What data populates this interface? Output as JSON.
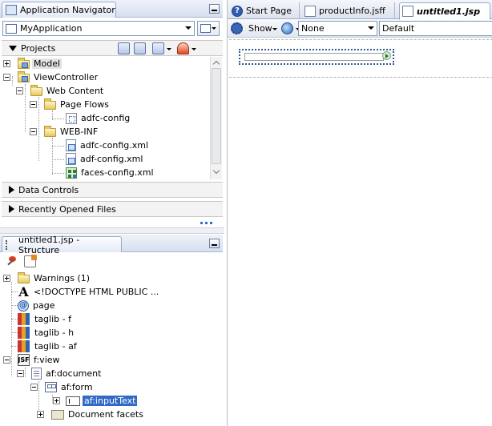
{
  "navigator": {
    "title": "Application Navigator",
    "application": "MyApplication",
    "sections": {
      "projects": "Projects",
      "data_controls": "Data Controls",
      "recent_files": "Recently Opened Files"
    },
    "tree": [
      {
        "label": "Model",
        "icon": "project-folder-icon",
        "state": "collapsed",
        "highlighted": true
      },
      {
        "label": "ViewController",
        "icon": "project-folder-icon",
        "state": "expanded"
      },
      {
        "label": "Web Content",
        "icon": "folder-icon",
        "state": "expanded"
      },
      {
        "label": "Page Flows",
        "icon": "folder-icon",
        "state": "expanded"
      },
      {
        "label": "adfc-config",
        "icon": "diagram-icon"
      },
      {
        "label": "WEB-INF",
        "icon": "folder-icon",
        "state": "expanded"
      },
      {
        "label": "adfc-config.xml",
        "icon": "xml-file-icon"
      },
      {
        "label": "adf-config.xml",
        "icon": "xml-file-icon"
      },
      {
        "label": "faces-config.xml",
        "icon": "faces-config-icon"
      }
    ]
  },
  "structure": {
    "title": "untitled1.jsp - Structure",
    "tree": [
      {
        "label": "Warnings (1)",
        "icon": "folder-icon",
        "state": "collapsed"
      },
      {
        "label": "<!DOCTYPE HTML PUBLIC ...",
        "icon": "doctype-icon"
      },
      {
        "label": "page",
        "icon": "directive-icon"
      },
      {
        "label": "taglib - f",
        "icon": "taglib-icon"
      },
      {
        "label": "taglib - h",
        "icon": "taglib-icon"
      },
      {
        "label": "taglib - af",
        "icon": "taglib-icon"
      },
      {
        "label": "f:view",
        "icon": "jsf-icon",
        "state": "expanded"
      },
      {
        "label": "af:document",
        "icon": "document-icon",
        "state": "expanded"
      },
      {
        "label": "af:form",
        "icon": "form-icon",
        "state": "expanded"
      },
      {
        "label": "af:inputText",
        "icon": "input-text-icon",
        "state": "collapsed",
        "selected": true
      },
      {
        "label": "Document facets",
        "icon": "facets-folder-icon",
        "state": "collapsed"
      }
    ]
  },
  "editor": {
    "tabs": [
      {
        "label": "Start Page",
        "icon": "help-icon",
        "active": false
      },
      {
        "label": "productInfo.jsff",
        "icon": "page-icon",
        "active": false
      },
      {
        "label": "untitled1.jsp",
        "icon": "page-icon",
        "active": true
      }
    ],
    "toolbar": {
      "show_label": "Show",
      "css_select": "None",
      "skin_select": "Default"
    }
  },
  "colors": {
    "selection": "#316ac5",
    "title_bar": "#d6dff0",
    "accent": "#2d5893"
  }
}
